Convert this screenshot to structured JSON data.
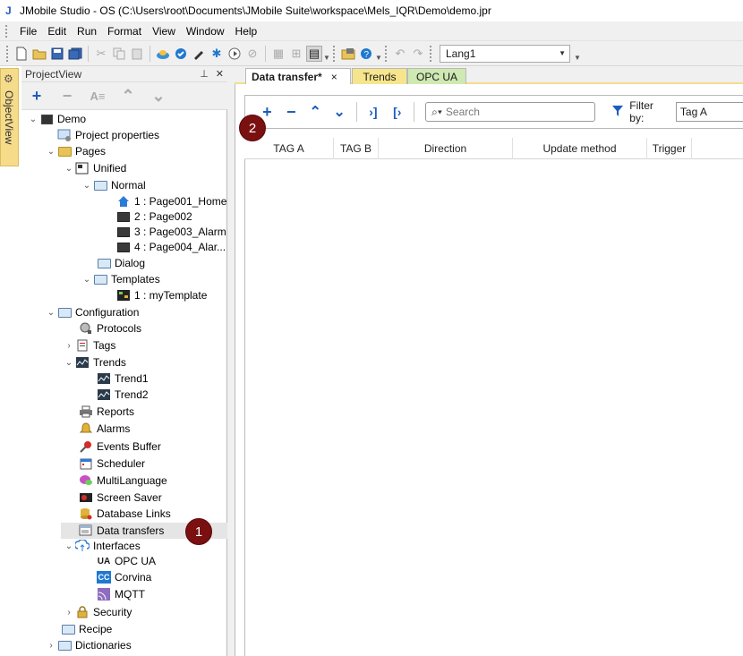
{
  "window": {
    "title": "JMobile Studio - OS (C:\\Users\\root\\Documents\\JMobile Suite\\workspace\\Mels_IQR\\Demo\\demo.jpr"
  },
  "menu": {
    "items": [
      "File",
      "Edit",
      "Run",
      "Format",
      "View",
      "Window",
      "Help"
    ]
  },
  "toolbar": {
    "language": "Lang1"
  },
  "object_view": {
    "label": "ObjectView"
  },
  "project_view": {
    "title": "ProjectView",
    "tree": [
      {
        "label": "Demo",
        "icon": "hmi-device-icon"
      },
      {
        "label": "Project properties",
        "icon": "properties-icon"
      },
      {
        "label": "Pages",
        "icon": "folder-icon"
      },
      {
        "label": "Unified",
        "icon": "unified-icon"
      },
      {
        "label": "Normal",
        "icon": "folder-icon"
      },
      {
        "label": "1 : Page001_Home",
        "icon": "home-icon"
      },
      {
        "label": "2 : Page002",
        "icon": "page-icon"
      },
      {
        "label": "3 : Page003_Alarm",
        "icon": "page-icon"
      },
      {
        "label": "4 : Page004_Alar...",
        "icon": "page-icon"
      },
      {
        "label": "Dialog",
        "icon": "folder-icon"
      },
      {
        "label": "Templates",
        "icon": "folder-icon"
      },
      {
        "label": "1 : myTemplate",
        "icon": "template-icon"
      },
      {
        "label": "Configuration",
        "icon": "folder-icon"
      },
      {
        "label": "Protocols",
        "icon": "protocols-icon"
      },
      {
        "label": "Tags",
        "icon": "tags-icon"
      },
      {
        "label": "Trends",
        "icon": "trend-icon"
      },
      {
        "label": "Trend1",
        "icon": "trend-icon"
      },
      {
        "label": "Trend2",
        "icon": "trend-icon"
      },
      {
        "label": "Reports",
        "icon": "printer-icon"
      },
      {
        "label": "Alarms",
        "icon": "bell-icon"
      },
      {
        "label": "Events Buffer",
        "icon": "pin-icon"
      },
      {
        "label": "Scheduler",
        "icon": "calendar-icon"
      },
      {
        "label": "MultiLanguage",
        "icon": "speech-icon"
      },
      {
        "label": "Screen Saver",
        "icon": "screensaver-icon"
      },
      {
        "label": "Database Links",
        "icon": "database-icon"
      },
      {
        "label": "Data transfers",
        "icon": "data-transfer-icon"
      },
      {
        "label": "Interfaces",
        "icon": "interfaces-icon"
      },
      {
        "label": "OPC UA",
        "icon": "opcua-icon"
      },
      {
        "label": "Corvina",
        "icon": "corvina-icon"
      },
      {
        "label": "MQTT",
        "icon": "mqtt-icon"
      },
      {
        "label": "Security",
        "icon": "lock-icon"
      },
      {
        "label": "Recipe",
        "icon": "folder-icon"
      },
      {
        "label": "Dictionaries",
        "icon": "folder-icon"
      }
    ]
  },
  "editor": {
    "tabs": [
      {
        "label": "Data transfer*",
        "close": "×"
      },
      {
        "label": "Trends"
      },
      {
        "label": "OPC UA"
      }
    ],
    "search": {
      "placeholder": "Search"
    },
    "filter": {
      "label": "Filter by:",
      "value": "Tag A"
    },
    "columns": [
      "TAG A",
      "TAG B",
      "Direction",
      "Update method",
      "Trigger"
    ]
  },
  "annotations": {
    "step1": "1",
    "step2": "2",
    "color": "#7a1010"
  }
}
